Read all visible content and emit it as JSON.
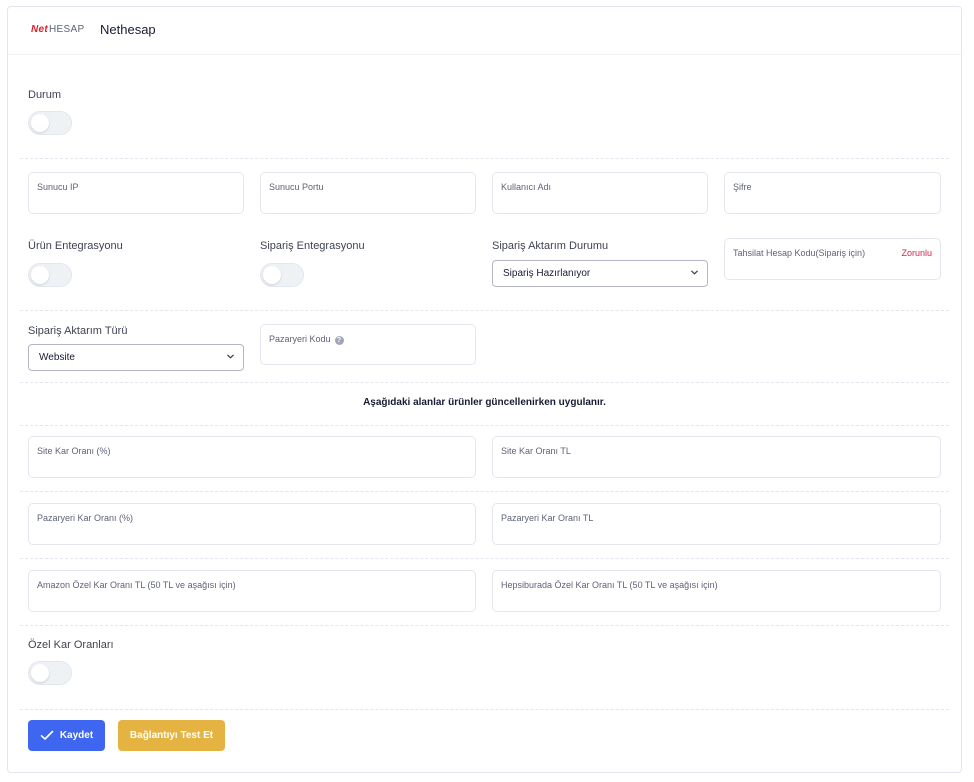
{
  "header": {
    "logo_net": "Net",
    "logo_hesap": "HESAP",
    "title": "Nethesap"
  },
  "durum": {
    "label": "Durum",
    "enabled": false
  },
  "connection": {
    "server_ip": {
      "label": "Sunucu IP",
      "value": ""
    },
    "server_port": {
      "label": "Sunucu Portu",
      "value": ""
    },
    "username": {
      "label": "Kullanıcı Adı",
      "value": ""
    },
    "password": {
      "label": "Şifre",
      "value": ""
    }
  },
  "integration": {
    "product_label": "Ürün Entegrasyonu",
    "product_enabled": false,
    "order_label": "Sipariş Entegrasyonu",
    "order_enabled": false,
    "transfer_status_label": "Sipariş Aktarım Durumu",
    "transfer_status_value": "Sipariş Hazırlanıyor",
    "collection_account": {
      "label": "Tahsilat Hesap Kodu(Sipariş için)",
      "required": "Zorunlu",
      "value": ""
    }
  },
  "transfer": {
    "type_label": "Sipariş Aktarım Türü",
    "type_value": "Website",
    "marketplace_code": {
      "label": "Pazaryeri Kodu",
      "help": "?",
      "value": ""
    }
  },
  "notice": "Aşağıdaki alanlar ürünler güncellenirken uygulanır.",
  "margins": {
    "site_percent": {
      "label": "Site Kar Oranı (%)",
      "value": ""
    },
    "site_tl": {
      "label": "Site Kar Oranı TL",
      "value": ""
    },
    "market_percent": {
      "label": "Pazaryeri Kar Oranı (%)",
      "value": ""
    },
    "market_tl": {
      "label": "Pazaryeri Kar Oranı TL",
      "value": ""
    },
    "amazon_tl": {
      "label": "Amazon Özel Kar Oranı TL (50 TL ve aşağısı için)",
      "value": ""
    },
    "hepsiburada_tl": {
      "label": "Hepsiburada Özel Kar Oranı TL (50 TL ve aşağısı için)",
      "value": ""
    }
  },
  "special_margins": {
    "label": "Özel Kar Oranları",
    "enabled": false
  },
  "actions": {
    "save": "Kaydet",
    "test": "Bağlantıyı Test Et"
  },
  "colors": {
    "primary": "#3e66f0",
    "warning": "#e5b342",
    "danger": "#d9214e",
    "brand_red": "#e41e26"
  }
}
